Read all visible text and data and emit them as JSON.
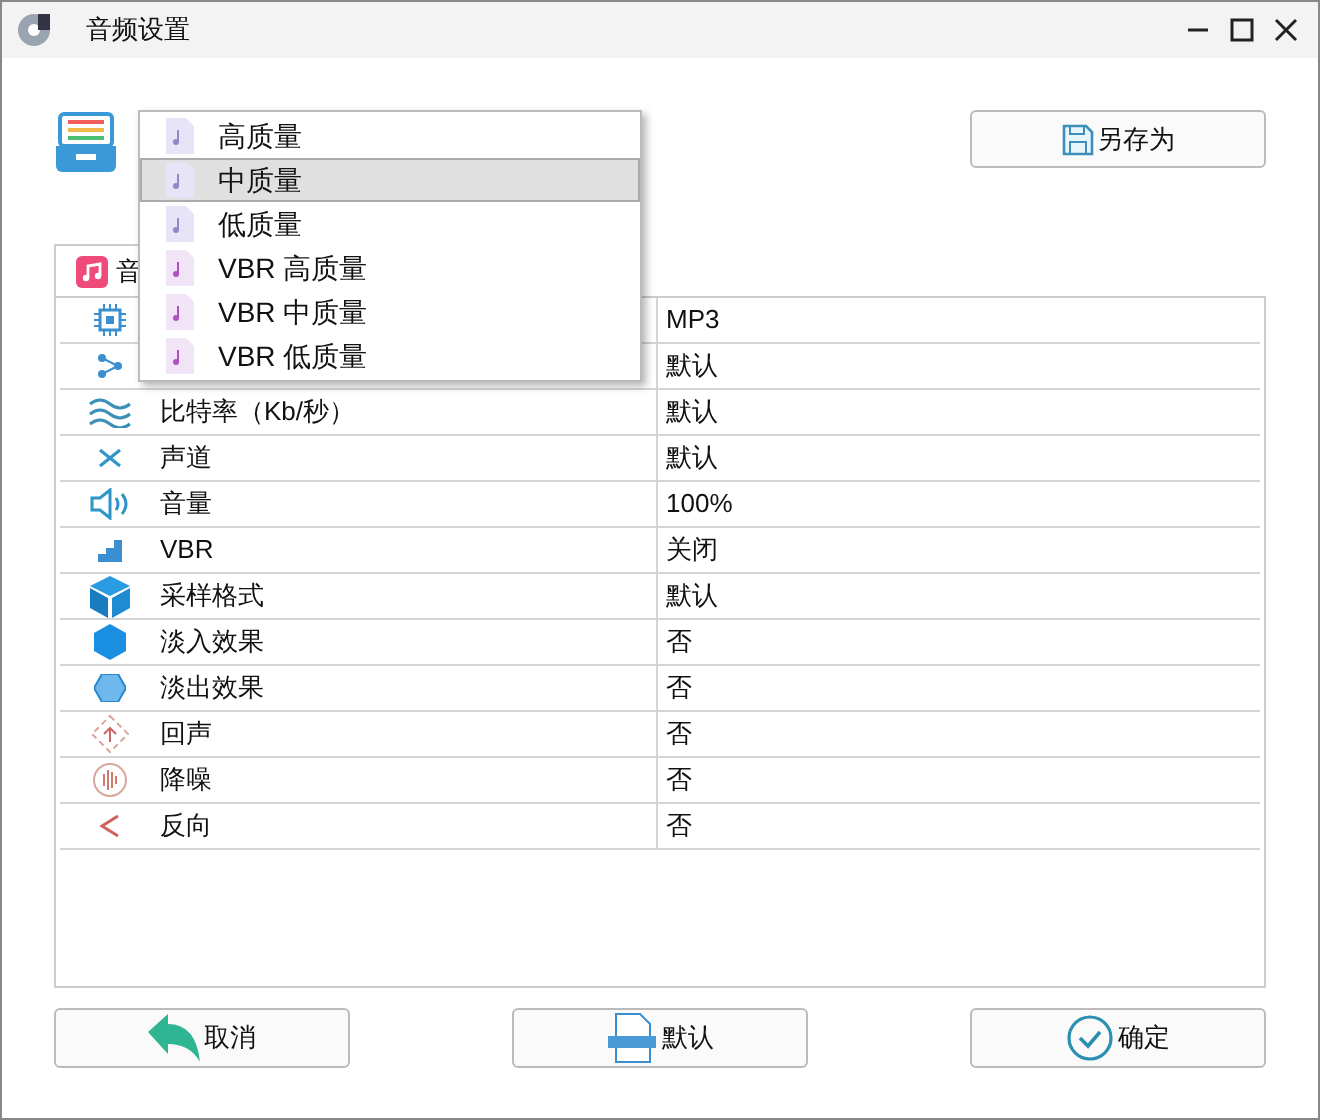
{
  "window": {
    "title": "音频设置"
  },
  "preset_menu": {
    "items": [
      {
        "label": "高质量",
        "kind": "cbr",
        "selected": false
      },
      {
        "label": "中质量",
        "kind": "cbr",
        "selected": true
      },
      {
        "label": "低质量",
        "kind": "cbr",
        "selected": false
      },
      {
        "label": "VBR 高质量",
        "kind": "vbr",
        "selected": false
      },
      {
        "label": "VBR 中质量",
        "kind": "vbr",
        "selected": false
      },
      {
        "label": "VBR 低质量",
        "kind": "vbr",
        "selected": false
      }
    ]
  },
  "save_as_button": "另存为",
  "tabs": [
    {
      "label": "音",
      "selected": true
    }
  ],
  "properties": [
    {
      "value": "MP3"
    },
    {
      "value": "默认"
    },
    {
      "label": "比特率（Kb/秒）",
      "value": "默认"
    },
    {
      "label": "声道",
      "value": "默认"
    },
    {
      "label": "音量",
      "value": "100%"
    },
    {
      "label": "VBR",
      "value": "关闭"
    },
    {
      "label": "采样格式",
      "value": "默认"
    },
    {
      "label": "淡入效果",
      "value": "否"
    },
    {
      "label": "淡出效果",
      "value": "否"
    },
    {
      "label": "回声",
      "value": "否"
    },
    {
      "label": "降噪",
      "value": "否"
    },
    {
      "label": "反向",
      "value": "否"
    }
  ],
  "buttons": [
    {
      "label": "取消",
      "kind": "cancel"
    },
    {
      "label": "默认",
      "kind": "default"
    },
    {
      "label": "确定",
      "kind": "ok"
    }
  ]
}
